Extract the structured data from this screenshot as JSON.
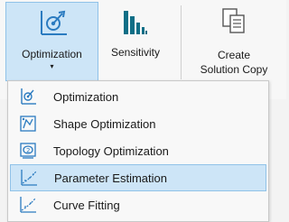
{
  "ribbon": {
    "optimization_label": "Optimization",
    "optimization_caret": "▾",
    "sensitivity_label": "Sensitivity",
    "create_copy_line1": "Create",
    "create_copy_line2": "Solution Copy",
    "group_label_fragment": "s"
  },
  "menu": {
    "items": [
      {
        "label": "Optimization",
        "icon": "optimization-icon"
      },
      {
        "label": "Shape Optimization",
        "icon": "shape-optimization-icon"
      },
      {
        "label": "Topology Optimization",
        "icon": "topology-optimization-icon"
      },
      {
        "label": "Parameter Estimation",
        "icon": "parameter-estimation-icon",
        "highlighted": true
      },
      {
        "label": "Curve Fitting",
        "icon": "curve-fitting-icon"
      }
    ]
  },
  "colors": {
    "highlight_bg": "#cde5f7",
    "highlight_border": "#90c2e8",
    "icon_blue": "#2b7bc0",
    "icon_teal": "#0f6e86"
  }
}
